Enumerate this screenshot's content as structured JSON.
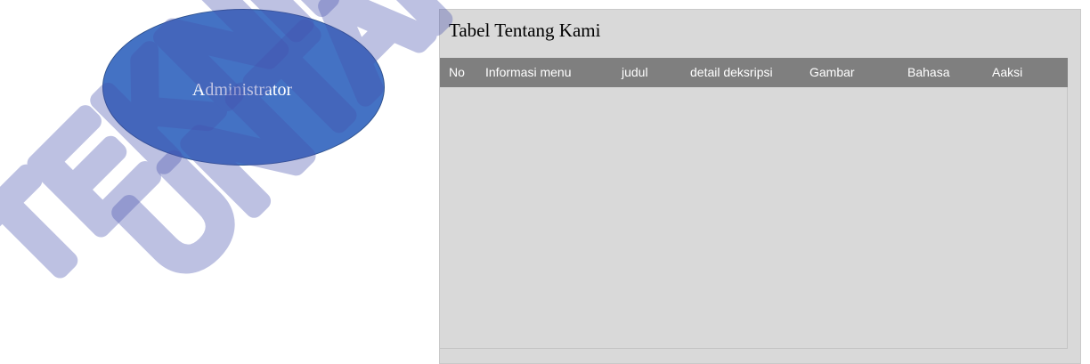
{
  "ellipse": {
    "label": "Administrator"
  },
  "panel": {
    "title": "Tabel Tentang Kami",
    "columns": [
      "No",
      "Informasi menu",
      "judul",
      "detail deksripsi",
      "Gambar",
      "Bahasa",
      "Aaksi"
    ]
  },
  "colors": {
    "ellipse_fill": "#4472c4",
    "panel_bg": "#d9d9d9",
    "header_bg": "#7f7f7f",
    "watermark": "#4650ad"
  }
}
